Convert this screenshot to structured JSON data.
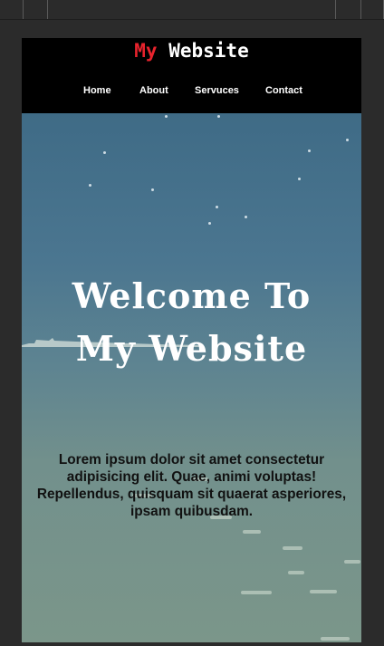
{
  "logo": {
    "part1": "My",
    "part2": "Website"
  },
  "nav": {
    "items": [
      {
        "label": "Home"
      },
      {
        "label": "About"
      },
      {
        "label": "Servuces"
      },
      {
        "label": "Contact"
      }
    ]
  },
  "hero": {
    "title": "Welcome To My Website",
    "text": "Lorem ipsum dolor sit amet consectetur adipisicing elit. Quae, animi voluptas! Repellendus, quisquam sit quaerat asperiores, ipsam quibusdam."
  },
  "colors": {
    "accent": "#e8232d",
    "header_bg": "#000000",
    "sky_top": "#3f6b86",
    "sea_bottom": "#7b968a"
  }
}
